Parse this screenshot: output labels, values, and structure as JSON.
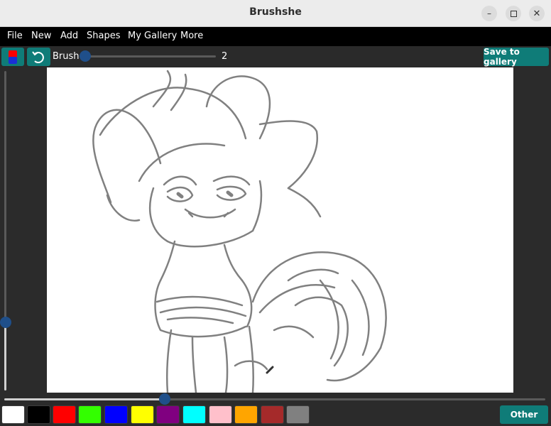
{
  "window": {
    "title": "Brushshe"
  },
  "menu": {
    "items": [
      "File",
      "New",
      "Add",
      "Shapes",
      "My Gallery",
      "More"
    ]
  },
  "toolbar": {
    "brush_label": "Brush:",
    "brush_size": "2",
    "brush_size_level": 0.0,
    "save_label": "Save to gallery"
  },
  "sliders": {
    "vertical_level": 0.2,
    "horizontal_level": 0.29
  },
  "palette": {
    "colors": [
      "#ffffff",
      "#000000",
      "#ff0000",
      "#33ff00",
      "#0000ff",
      "#ffff00",
      "#800080",
      "#00ffff",
      "#ffc0cb",
      "#ffa500",
      "#a52a2a",
      "#808080"
    ],
    "other_label": "Other"
  },
  "colors": {
    "accent": "#0f7c78",
    "knob": "#1f4f8a",
    "stroke": "#808080"
  }
}
